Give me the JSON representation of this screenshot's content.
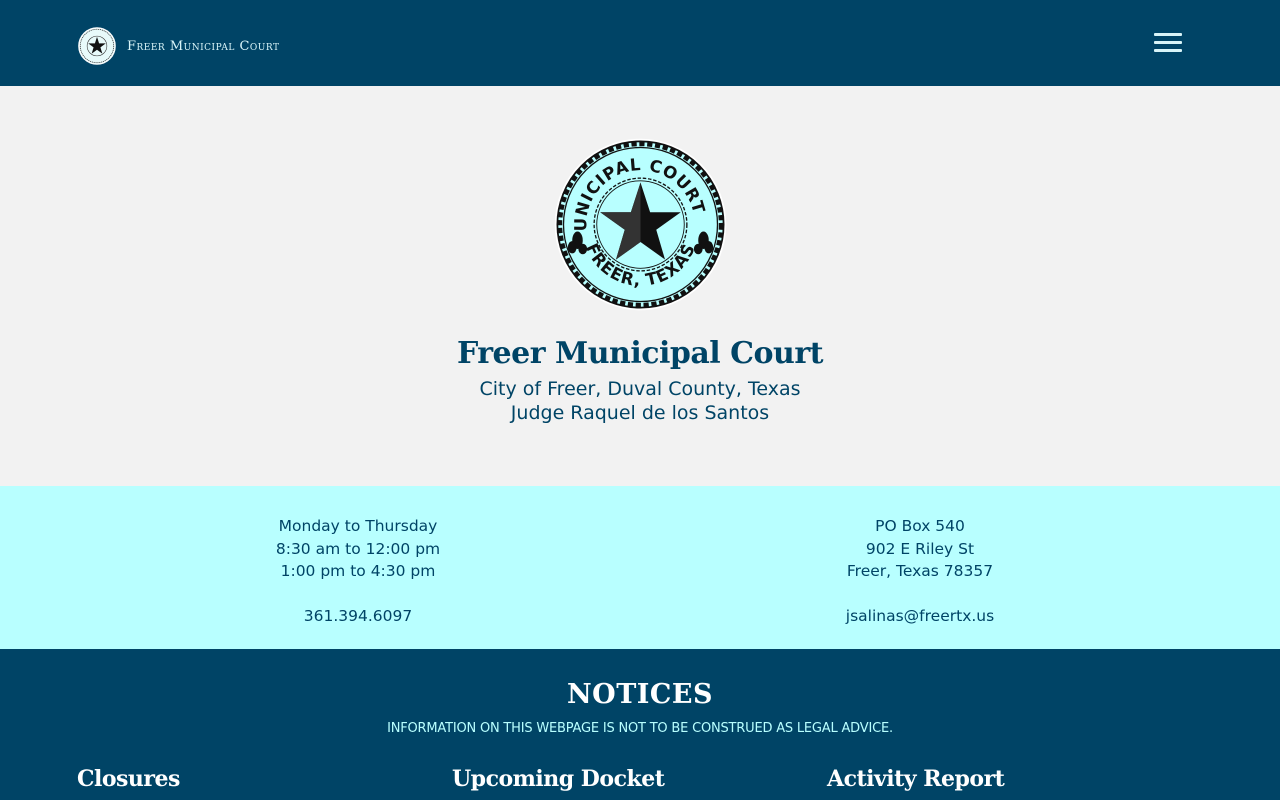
{
  "navbar": {
    "brand_text": "Freer Municipal Court",
    "logo_icon": "court-seal-icon",
    "menu_icon": "hamburger-menu-icon"
  },
  "hero": {
    "seal_text_top": "MUNICIPAL COURT OF",
    "seal_text_bottom": "FREER, TEXAS",
    "title": "Freer Municipal Court",
    "subtitle_line1": "City of Freer, Duval County, Texas",
    "subtitle_line2": "Judge Raquel de los Santos"
  },
  "info": {
    "hours": [
      "Monday to Thursday",
      "8:30 am to 12:00 pm",
      "1:00 pm to 4:30 pm"
    ],
    "phone": "361.394.6097",
    "address": [
      "PO Box 540",
      "902 E Riley St",
      "Freer, Texas 78357"
    ],
    "email": "jsalinas@freertx.us"
  },
  "notices": {
    "title": "NOTICES",
    "disclaimer": "INFORMATION ON THIS WEBPAGE IS NOT TO BE CONSTRUED AS LEGAL ADVICE.",
    "columns": [
      {
        "heading": "Closures"
      },
      {
        "heading": "Upcoming Docket"
      },
      {
        "heading": "Activity Report"
      }
    ]
  },
  "colors": {
    "navy": "#004466",
    "aqua": "#b8ffff",
    "light_gray": "#f2f2f2"
  }
}
